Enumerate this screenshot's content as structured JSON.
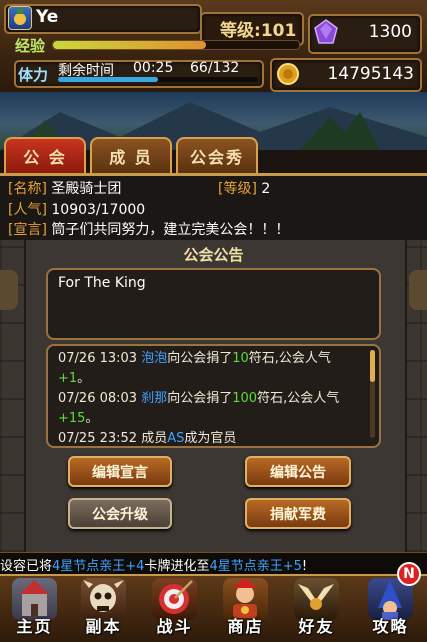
{
  "player": {
    "name": "Ye",
    "level_label": "等级:",
    "level_value": "101",
    "exp_label": "经验",
    "exp_fraction": 0.62,
    "stamina_label": "体力",
    "stamina_time_label": "剩余时间",
    "stamina_time": "00:25",
    "stamina_value": "66/132",
    "stamina_fraction": 0.5,
    "gems": "1300",
    "gold": "14795143"
  },
  "tabs": [
    {
      "label": "公 会",
      "active": true
    },
    {
      "label": "成 员",
      "active": false
    },
    {
      "label": "公会秀",
      "active": false
    }
  ],
  "guild": {
    "name_label": "[名称]",
    "name": "圣殿骑士团",
    "level_label": "[等级]",
    "level": "2",
    "pop_label": "[人气]",
    "pop": "10903/17000",
    "decl_label": "[宣言]",
    "decl": "筒子们共同努力，建立完美公会！！！"
  },
  "announcement": {
    "title": "公会公告",
    "text": "For The King"
  },
  "log": [
    {
      "time": "07/26 13:03 ",
      "name": "泡泡",
      "mid": "向公会捐了",
      "amt": "10",
      "tail": "符石,公会人气",
      "plus": "+1",
      "end": "。"
    },
    {
      "time": "07/26 08:03 ",
      "name": "刹那",
      "mid": "向公会捐了",
      "amt": "100",
      "tail": "符石,公会人气",
      "plus": "+15",
      "end": "。"
    },
    {
      "time": "07/25 23:52 ",
      "pre": "成员",
      "name": "AS",
      "mid": "成为官员"
    }
  ],
  "buttons": {
    "edit_decl": "编辑宣言",
    "edit_notice": "编辑公告",
    "upgrade": "公会升级",
    "donate": "捐献军费"
  },
  "ticker": {
    "a": "设容已将",
    "b": "4星节点亲王+4",
    "c": "卡牌进化至",
    "d": "4星节点亲王+5",
    "e": "!"
  },
  "nav": [
    {
      "label": "主页",
      "icon": "castle-icon"
    },
    {
      "label": "副本",
      "icon": "skull-icon"
    },
    {
      "label": "战斗",
      "icon": "target-icon"
    },
    {
      "label": "商店",
      "icon": "merchant-icon"
    },
    {
      "label": "好友",
      "icon": "wings-icon"
    },
    {
      "label": "攻略",
      "icon": "wizard-icon"
    }
  ],
  "nav_badge": "N"
}
